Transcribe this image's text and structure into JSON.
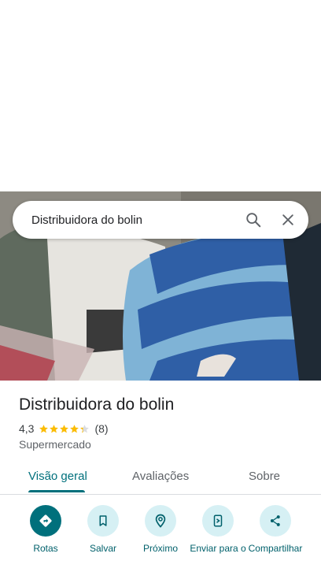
{
  "search": {
    "query": "Distribuidora do bolin"
  },
  "place": {
    "name": "Distribuidora do bolin",
    "rating": "4,3",
    "stars": 4.3,
    "review_count": "(8)",
    "category": "Supermercado"
  },
  "tabs": [
    {
      "label": "Visão geral",
      "active": true
    },
    {
      "label": "Avaliações",
      "active": false
    },
    {
      "label": "Sobre",
      "active": false
    }
  ],
  "actions": [
    {
      "label": "Rotas",
      "icon": "directions-icon"
    },
    {
      "label": "Salvar",
      "icon": "bookmark-icon"
    },
    {
      "label": "Próximo",
      "icon": "nearby-icon"
    },
    {
      "label": "Enviar para o",
      "icon": "send-to-phone-icon"
    },
    {
      "label": "Compartilhar",
      "icon": "share-icon"
    }
  ],
  "colors": {
    "accent": "#00707c",
    "action_bg": "#d6f0f4",
    "star": "#fbbc04"
  }
}
